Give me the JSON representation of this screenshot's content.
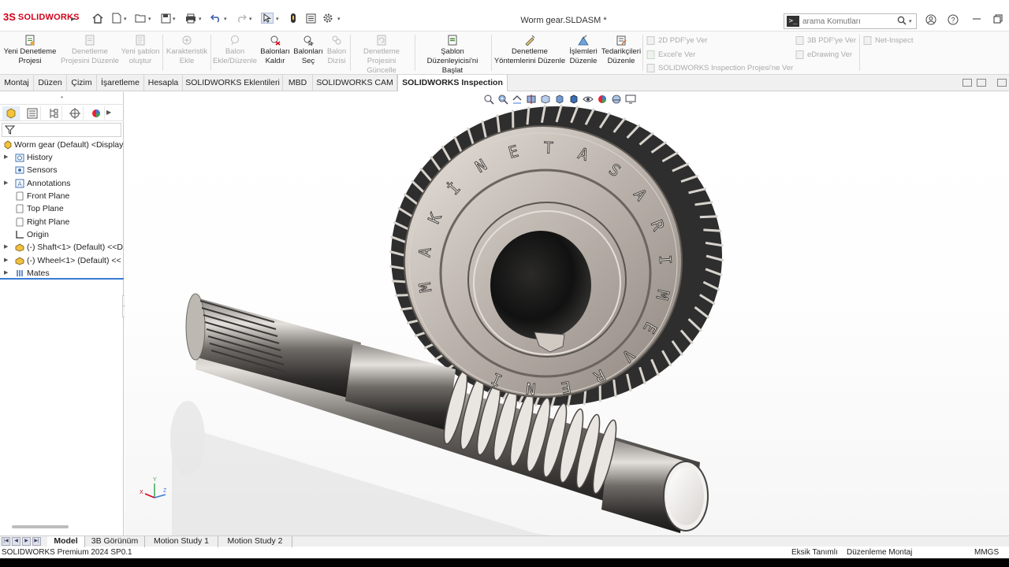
{
  "app": {
    "logo_ds": "3S",
    "logo_text": "SOLIDWORKS",
    "document_title": "Worm gear.SLDASM *"
  },
  "command_search": {
    "prompt_icon": ">_",
    "placeholder": "arama Komutları"
  },
  "ribbon": {
    "buttons": [
      {
        "label_1": "Yeni Denetleme",
        "label_2": "Projesi",
        "enabled": true
      },
      {
        "label_1": "Denetleme",
        "label_2": "Projesini Düzenle",
        "enabled": false
      },
      {
        "label_1": "Yeni şablon",
        "label_2": "oluştur",
        "enabled": false
      },
      {
        "label_1": "Karakteristik",
        "label_2": "Ekle",
        "enabled": false
      },
      {
        "label_1": "Balon",
        "label_2": "Ekle/Düzenle",
        "enabled": false
      },
      {
        "label_1": "Balonları",
        "label_2": "Kaldır",
        "enabled": true
      },
      {
        "label_1": "Balonları",
        "label_2": "Seç",
        "enabled": true
      },
      {
        "label_1": "Balon",
        "label_2": "Dizisi",
        "enabled": false
      },
      {
        "label_1": "Denetleme",
        "label_2": "Projesini Güncelle",
        "enabled": false
      },
      {
        "label_1": "Şablon",
        "label_2": "Düzenleyicisi'ni Başlat",
        "enabled": true
      },
      {
        "label_1": "Denetleme",
        "label_2": "Yöntemlerini Düzenle",
        "enabled": true
      },
      {
        "label_1": "İşlemleri",
        "label_2": "Düzenle",
        "enabled": true
      },
      {
        "label_1": "Tedarikçileri",
        "label_2": "Düzenle",
        "enabled": true
      }
    ],
    "small": {
      "pdf2d": "2D PDF'ye Ver",
      "excel": "Excel'e Ver",
      "inspection_project": "SOLIDWORKS Inspection Projesi'ne Ver",
      "pdf3d": "3B PDF'ye Ver",
      "edrawing": "eDrawing Ver",
      "net_inspect": "Net-Inspect"
    }
  },
  "tabs": [
    "Montaj",
    "Düzen",
    "Çizim",
    "İşaretleme",
    "Hesapla",
    "SOLIDWORKS Eklentileri",
    "MBD",
    "SOLIDWORKS CAM",
    "SOLIDWORKS Inspection"
  ],
  "active_tab": "SOLIDWORKS Inspection",
  "tree": {
    "root": "Worm gear (Default) <Display",
    "items": [
      {
        "label": "History",
        "icon": "history-folder-icon",
        "expandable": true
      },
      {
        "label": "Sensors",
        "icon": "sensors-icon",
        "expandable": false
      },
      {
        "label": "Annotations",
        "icon": "annotations-icon",
        "expandable": true
      },
      {
        "label": "Front Plane",
        "icon": "plane-icon",
        "expandable": false
      },
      {
        "label": "Top Plane",
        "icon": "plane-icon",
        "expandable": false
      },
      {
        "label": "Right Plane",
        "icon": "plane-icon",
        "expandable": false
      },
      {
        "label": "Origin",
        "icon": "origin-icon",
        "expandable": false
      },
      {
        "label": "(-) Shaft<1> (Default) <<D",
        "icon": "part-icon",
        "expandable": true
      },
      {
        "label": "(-) Wheel<1> (Default) <<",
        "icon": "part-icon",
        "expandable": true
      },
      {
        "label": "Mates",
        "icon": "mates-icon",
        "expandable": true
      }
    ]
  },
  "model": {
    "gear_text": [
      "M",
      "A",
      "K",
      "İ",
      "N",
      "E",
      "T",
      "A",
      "S",
      "A",
      "R",
      "I",
      "M",
      "E",
      "V",
      "R",
      "E",
      "N",
      "İ"
    ]
  },
  "triad": {
    "x": "X",
    "y": "Y",
    "z": "Z"
  },
  "bottom_tabs": [
    "Model",
    "3B Görünüm",
    "Motion Study 1",
    "Motion Study 2"
  ],
  "active_bottom_tab": "Model",
  "status": {
    "version": "SOLIDWORKS Premium 2024 SP0.1",
    "definition": "Eksik Tanımlı",
    "mode": "Düzenleme Montaj",
    "units": "MMGS"
  },
  "colors": {
    "accent_blue": "#3a7bd5",
    "brand_red": "#d0021b",
    "metal_dark": "#2e2e2e"
  }
}
